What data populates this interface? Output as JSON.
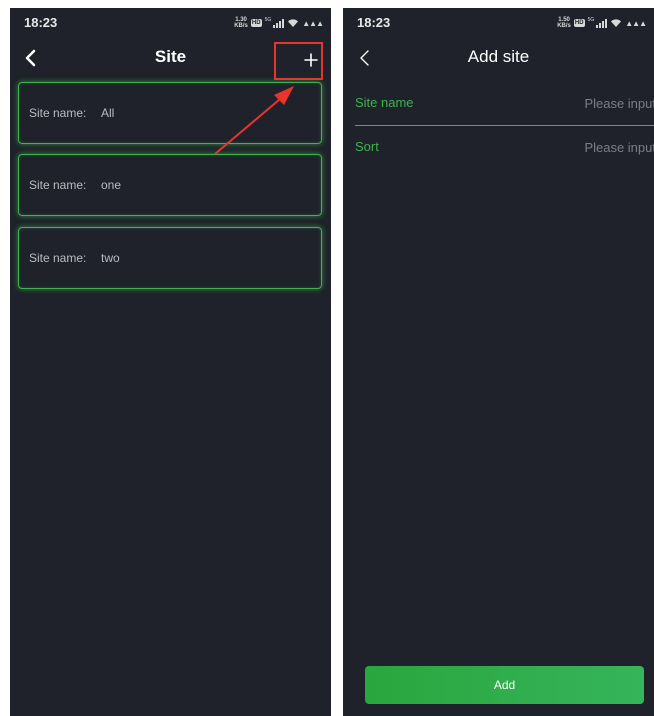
{
  "status_bar": {
    "left_time": "18:23",
    "left_speed_value": "1.30",
    "right_time": "18:23",
    "right_speed_value": "1.50",
    "speed_unit": "KB/s",
    "hd_label": "HD",
    "network_label": "5G"
  },
  "site_list_screen": {
    "title": "Site",
    "back_icon": "chevron-left-icon",
    "add_icon": "plus-icon",
    "sites": [
      {
        "label": "Site name:",
        "value": "All"
      },
      {
        "label": "Site name:",
        "value": "one"
      },
      {
        "label": "Site name:",
        "value": "two"
      }
    ]
  },
  "add_site_screen": {
    "title": "Add site",
    "back_icon": "chevron-left-icon",
    "fields": [
      {
        "label": "Site name",
        "placeholder": "Please input",
        "value": ""
      },
      {
        "label": "Sort",
        "placeholder": "Please input",
        "value": ""
      }
    ],
    "submit_label": "Add"
  },
  "colors": {
    "background": "#1f222a",
    "accent_green": "#3fb24e",
    "highlight_red": "#e8342c"
  }
}
